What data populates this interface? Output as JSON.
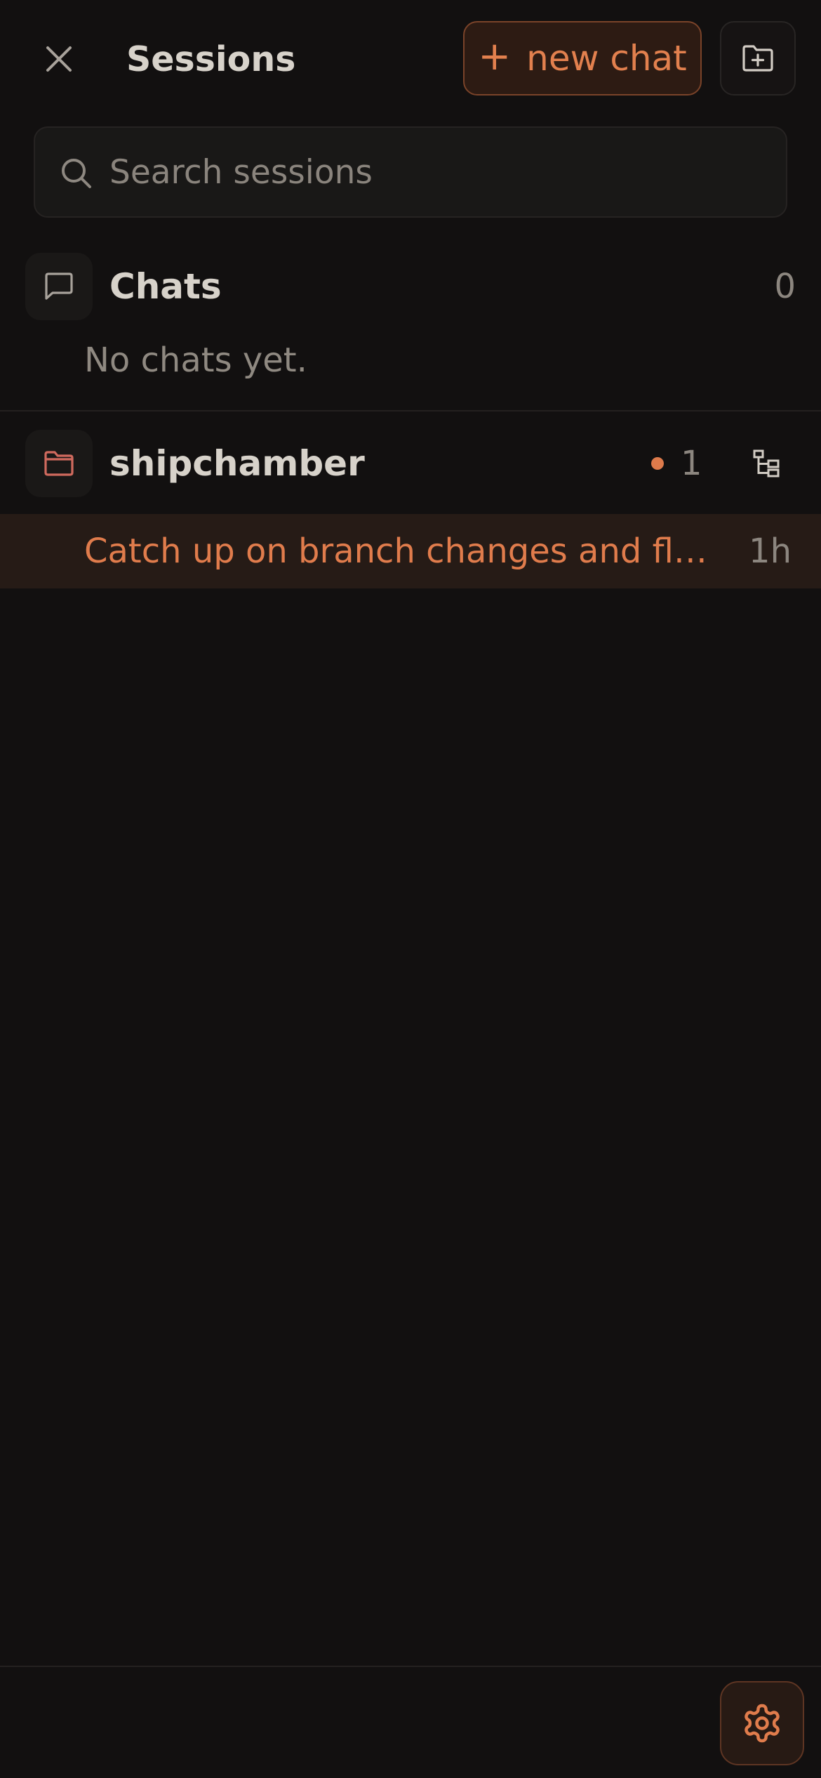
{
  "header": {
    "title": "Sessions",
    "new_chat_label": "new chat",
    "new_chat_plus": "+",
    "close_icon": "close-icon",
    "new_folder_icon": "folder-plus-icon"
  },
  "search": {
    "placeholder": "Search sessions",
    "value": "",
    "icon": "search-icon"
  },
  "chats": {
    "label": "Chats",
    "count": "0",
    "empty_text": "No chats yet.",
    "icon": "chat-bubble-icon"
  },
  "project": {
    "name": "shipchamber",
    "count": "1",
    "icon": "folder-icon",
    "action_icon": "tree-structure-icon",
    "sessions": [
      {
        "title": "Catch up on branch changes and fl…",
        "time": "1h"
      }
    ]
  },
  "footer": {
    "settings_icon": "gear-icon"
  },
  "colors": {
    "background": "#121010",
    "accent": "#e07c4c",
    "muted_text": "#8c867f",
    "primary_text": "#d7d2ca",
    "folder_icon": "#d06a5e",
    "active_row": "#261b16"
  }
}
